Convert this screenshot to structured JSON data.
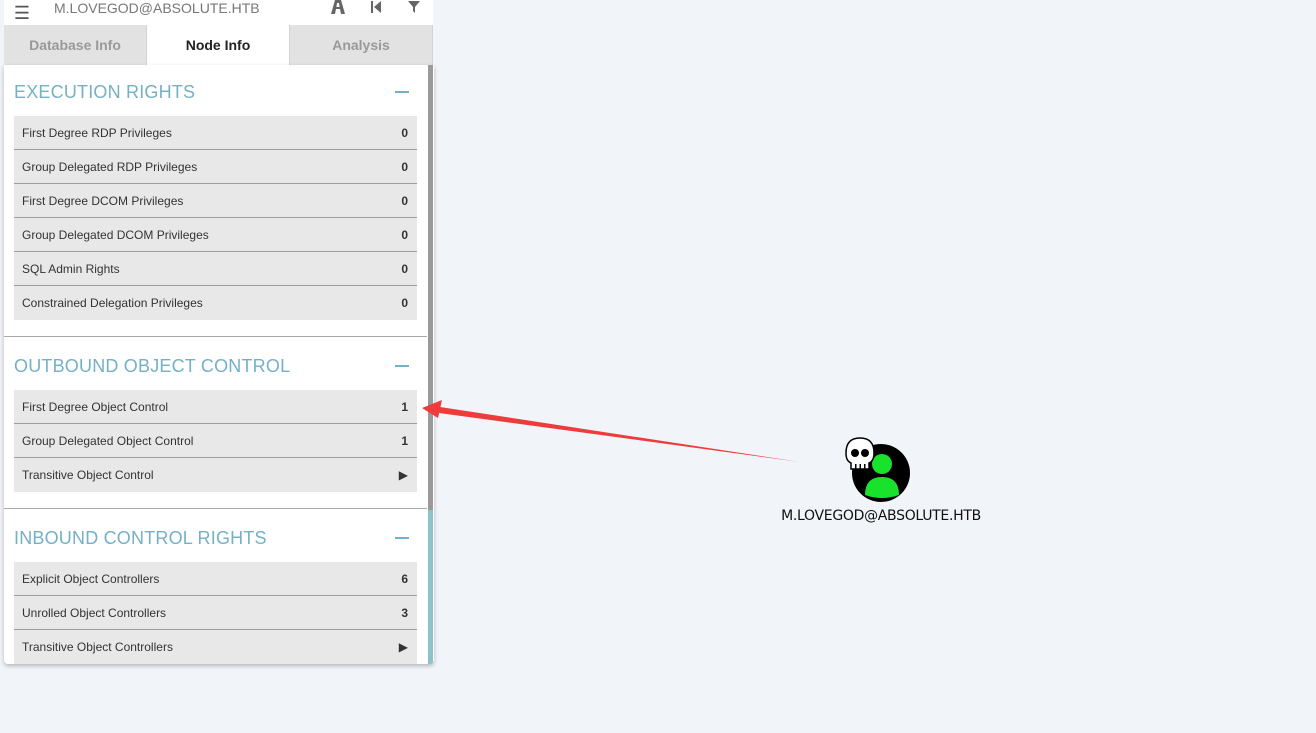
{
  "search": {
    "value": "M.LOVEGOD@ABSOLUTE.HTB"
  },
  "toolbar": {
    "menu_icon": "hamburger-icon",
    "path_icon": "road-icon",
    "back_icon": "step-back-icon",
    "filter_icon": "filter-icon"
  },
  "tabs": [
    {
      "label": "Database Info",
      "active": false
    },
    {
      "label": "Node Info",
      "active": true
    },
    {
      "label": "Analysis",
      "active": false
    }
  ],
  "sections": {
    "execution": {
      "title": "EXECUTION RIGHTS",
      "rows": [
        {
          "label": "First Degree RDP Privileges",
          "value": "0"
        },
        {
          "label": "Group Delegated RDP Privileges",
          "value": "0"
        },
        {
          "label": "First Degree DCOM Privileges",
          "value": "0"
        },
        {
          "label": "Group Delegated DCOM Privileges",
          "value": "0"
        },
        {
          "label": "SQL Admin Rights",
          "value": "0"
        },
        {
          "label": "Constrained Delegation Privileges",
          "value": "0"
        }
      ]
    },
    "outbound": {
      "title": "OUTBOUND OBJECT CONTROL",
      "rows": [
        {
          "label": "First Degree Object Control",
          "value": "1"
        },
        {
          "label": "Group Delegated Object Control",
          "value": "1"
        },
        {
          "label": "Transitive Object Control",
          "value": "▶"
        }
      ]
    },
    "inbound": {
      "title": "INBOUND CONTROL RIGHTS",
      "rows": [
        {
          "label": "Explicit Object Controllers",
          "value": "6"
        },
        {
          "label": "Unrolled Object Controllers",
          "value": "3"
        },
        {
          "label": "Transitive Object Controllers",
          "value": "▶"
        }
      ]
    }
  },
  "graph": {
    "node_label": "M.LOVEGOD@ABSOLUTE.HTB",
    "node_color": "#19e22d",
    "arrow_color": "#ee3b3b"
  }
}
